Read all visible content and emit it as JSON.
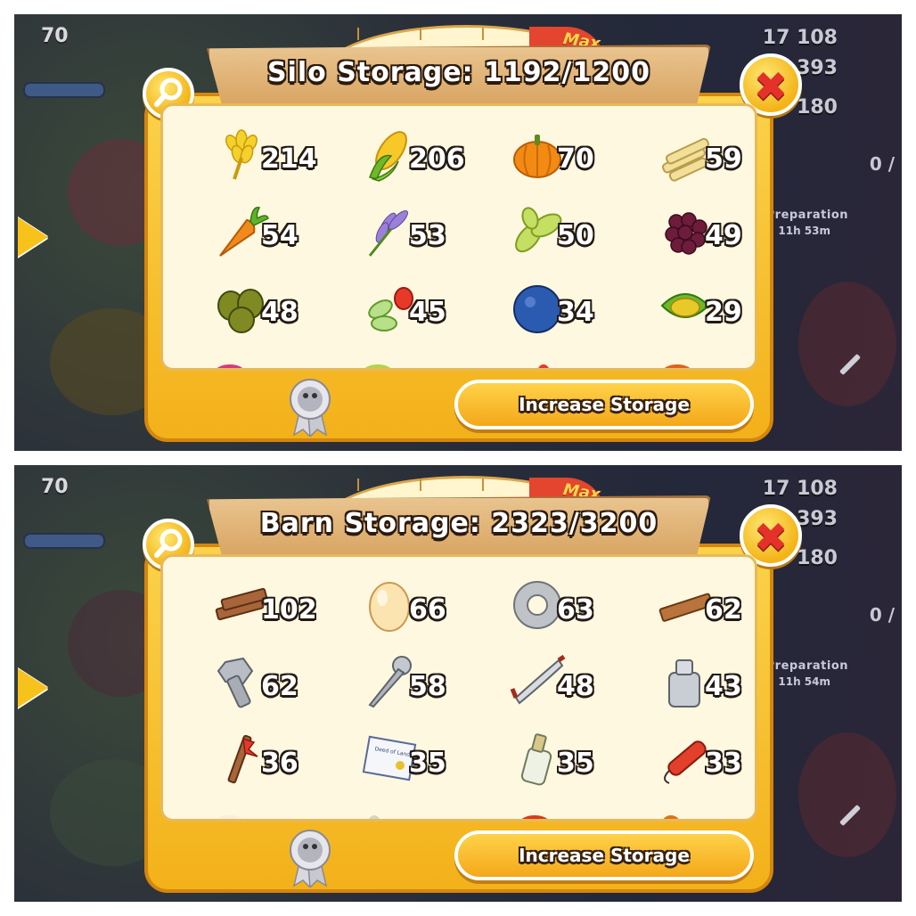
{
  "silo": {
    "title": "Silo Storage: 1192/1200",
    "fill_fraction": 0.9933,
    "meter_label": "Max",
    "button_label": "Increase Storage",
    "hud": {
      "level": "70",
      "coins": "17 108",
      "diamonds": "393",
      "xp": "180",
      "quota": "0 /",
      "prep_label": "Preparation",
      "prep_time": "11h 53m"
    },
    "items": [
      {
        "name": "wheat",
        "qty": "214"
      },
      {
        "name": "corn",
        "qty": "206"
      },
      {
        "name": "pumpkin",
        "qty": "70"
      },
      {
        "name": "sugarcane",
        "qty": "59"
      },
      {
        "name": "carrot",
        "qty": "54"
      },
      {
        "name": "lavender",
        "qty": "53"
      },
      {
        "name": "soybean",
        "qty": "50"
      },
      {
        "name": "blackberry",
        "qty": "49"
      },
      {
        "name": "olive",
        "qty": "48"
      },
      {
        "name": "pea",
        "qty": "45"
      },
      {
        "name": "blueberry",
        "qty": "34"
      },
      {
        "name": "chili-corn",
        "qty": "29"
      }
    ]
  },
  "barn": {
    "title": "Barn Storage: 2323/3200",
    "fill_fraction": 0.7259,
    "meter_label": "Max",
    "button_label": "Increase Storage",
    "hud": {
      "level": "70",
      "coins": "17 108",
      "diamonds": "393",
      "xp": "180",
      "quota": "0 /",
      "prep_label": "Preparation",
      "prep_time": "11h 54m"
    },
    "items": [
      {
        "name": "plank",
        "qty": "102"
      },
      {
        "name": "egg",
        "qty": "66"
      },
      {
        "name": "duct-tape",
        "qty": "63"
      },
      {
        "name": "board",
        "qty": "62"
      },
      {
        "name": "bolt",
        "qty": "62"
      },
      {
        "name": "screw",
        "qty": "58"
      },
      {
        "name": "saw",
        "qty": "48"
      },
      {
        "name": "milk-can",
        "qty": "43"
      },
      {
        "name": "land-stake",
        "qty": "36"
      },
      {
        "name": "deed-of-land",
        "qty": "35",
        "icon_text": "Deed of Land"
      },
      {
        "name": "bottle",
        "qty": "35"
      },
      {
        "name": "dynamite",
        "qty": "33"
      }
    ]
  },
  "colors": {
    "gold": "#f3b11a",
    "panel": "#fdf8df",
    "wood": "#d8a461",
    "close": "#e4322a"
  }
}
